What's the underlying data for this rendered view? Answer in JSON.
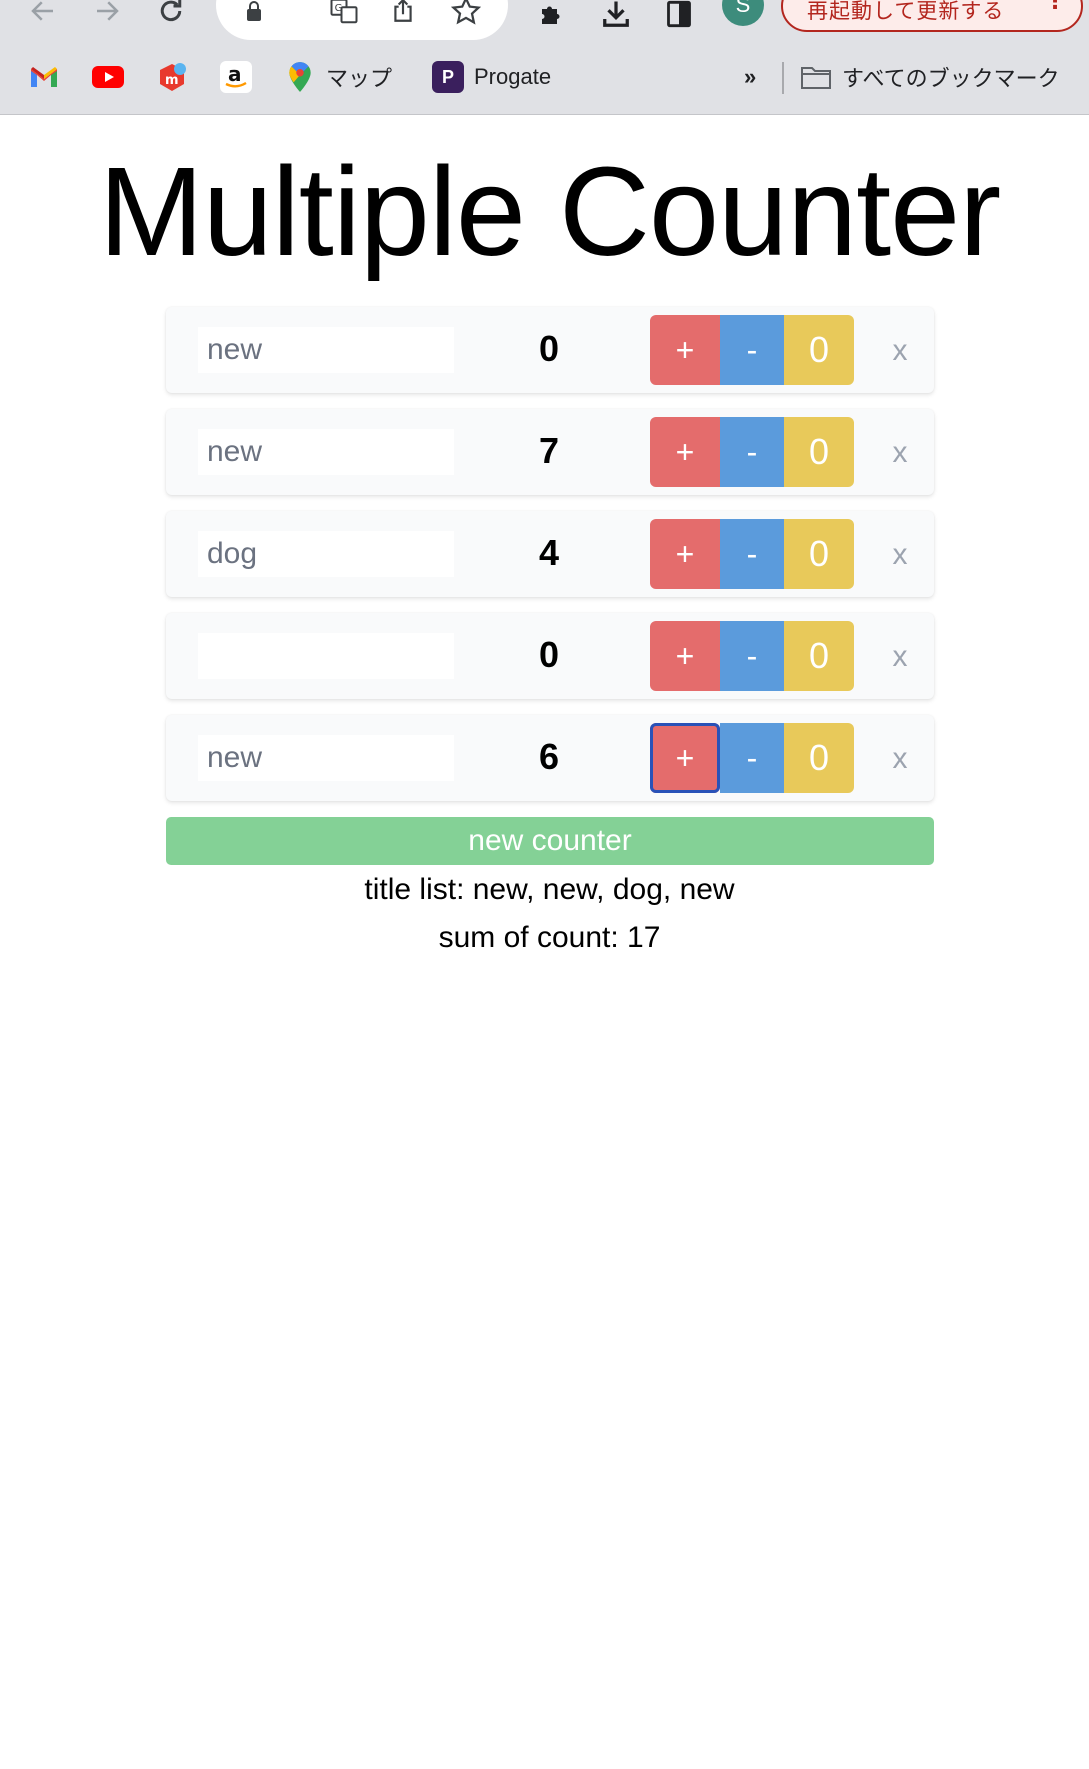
{
  "browser": {
    "restart_label": "再起動して更新する",
    "avatar_initial": "S",
    "overflow_label": "»",
    "bookmarks": [
      {
        "label": ""
      },
      {
        "label": ""
      },
      {
        "label": ""
      },
      {
        "label": ""
      },
      {
        "label": "マップ"
      },
      {
        "label": "Progate"
      }
    ],
    "all_bookmarks_label": "すべてのブックマーク"
  },
  "app": {
    "title": "Multiple Counter",
    "counters": [
      {
        "title": "new",
        "count": "0",
        "inc_label": "+",
        "dec_label": "-",
        "reset_label": "0",
        "delete_label": "x"
      },
      {
        "title": "new",
        "count": "7",
        "inc_label": "+",
        "dec_label": "-",
        "reset_label": "0",
        "delete_label": "x"
      },
      {
        "title": "dog",
        "count": "4",
        "inc_label": "+",
        "dec_label": "-",
        "reset_label": "0",
        "delete_label": "x"
      },
      {
        "title": "",
        "count": "0",
        "inc_label": "+",
        "dec_label": "-",
        "reset_label": "0",
        "delete_label": "x"
      },
      {
        "title": "new",
        "count": "6",
        "inc_label": "+",
        "dec_label": "-",
        "reset_label": "0",
        "delete_label": "x"
      }
    ],
    "new_counter_label": "new counter",
    "title_list_text": "title list: new, new, dog, new",
    "sum_text": "sum of count: 17"
  },
  "colors": {
    "increment": "#e46c6c",
    "decrement": "#5b9bdc",
    "reset": "#e8c95a",
    "new_counter": "#84d196"
  }
}
